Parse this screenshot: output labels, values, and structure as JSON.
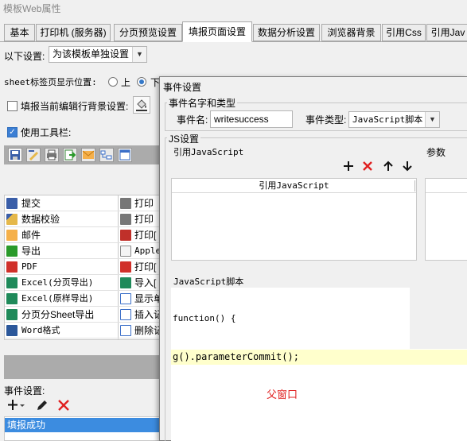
{
  "window": {
    "title": "模板Web属性"
  },
  "tabs": [
    {
      "label": "基本"
    },
    {
      "label": "打印机 (服务器)"
    },
    {
      "label": "分页预览设置"
    },
    {
      "label": "填报页面设置"
    },
    {
      "label": "数据分析设置"
    },
    {
      "label": "浏览器背景"
    },
    {
      "label": "引用Css"
    },
    {
      "label": "引用Jav"
    }
  ],
  "settings": {
    "scope_label": "以下设置:",
    "scope_value": "为该模板单独设置",
    "sheet_label": "sheet标签页显示位置:",
    "radio_top": "上",
    "radio_bottom": "下",
    "bg_label": "填报当前编辑行背景设置:",
    "toolbar_label": "使用工具栏:"
  },
  "buttons": {
    "left": [
      "提交",
      "数据校验",
      "邮件",
      "导出",
      "PDF",
      "Excel(分页导出)",
      "Excel(原样导出)",
      "分页分Sheet导出",
      "Word格式"
    ],
    "right": [
      "打印",
      "打印",
      "打印[",
      "Apple",
      "打印[",
      "导入[",
      "显示单",
      "插入记",
      "删除记"
    ]
  },
  "events": {
    "label": "事件设置:",
    "items": [
      "填报成功"
    ]
  },
  "dialog": {
    "title": "事件设置",
    "name_group_title": "事件名字和类型",
    "name_label": "事件名:",
    "name_value": "writesuccess",
    "type_label": "事件类型:",
    "type_value": "JavaScript脚本",
    "js_group_title": "JS设置",
    "ref_js_label": "引用JavaScript",
    "param_label": "参数",
    "table_header": "引用JavaScript",
    "script_label": "JavaScript脚本",
    "code_line1": "function() {",
    "code_line2": "g().parameterCommit();",
    "annotation": "父窗口"
  },
  "colors": {
    "accent": "#3c8ce0",
    "delete_red": "#e02020",
    "annotation_red": "#e02020",
    "code_highlight": "#ffffcc"
  }
}
